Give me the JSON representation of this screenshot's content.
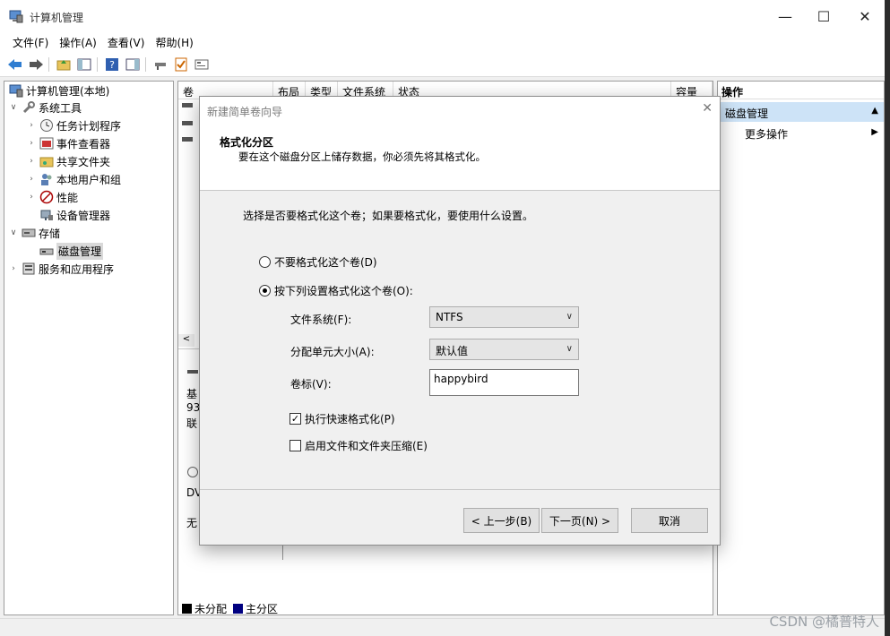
{
  "window": {
    "title": "计算机管理",
    "minimize": "—",
    "maximize": "☐",
    "close": "✕"
  },
  "menu": [
    "文件(F)",
    "操作(A)",
    "查看(V)",
    "帮助(H)"
  ],
  "tree": {
    "root": "计算机管理(本地)",
    "system_tools": "系统工具",
    "task_scheduler": "任务计划程序",
    "event_viewer": "事件查看器",
    "shared_folders": "共享文件夹",
    "local_users": "本地用户和组",
    "performance": "性能",
    "device_manager": "设备管理器",
    "storage": "存储",
    "disk_management": "磁盘管理",
    "services_apps": "服务和应用程序"
  },
  "center": {
    "columns": [
      "卷",
      "布局",
      "类型",
      "文件系统",
      "状态",
      "容量"
    ],
    "partial_texts": [
      "基",
      "93",
      "联",
      "DV",
      "无"
    ],
    "legend": [
      {
        "label": "未分配",
        "color": "#000000"
      },
      {
        "label": "主分区",
        "color": "#000080"
      }
    ]
  },
  "actions": {
    "header": "操作",
    "section": "磁盘管理",
    "more": "更多操作"
  },
  "dialog": {
    "title": "新建简单卷向导",
    "close": "✕",
    "heading": "格式化分区",
    "subheading": "要在这个磁盘分区上储存数据，你必须先将其格式化。",
    "instruction": "选择是否要格式化这个卷；如果要格式化，要使用什么设置。",
    "radio_no_format": "不要格式化这个卷(D)",
    "radio_format": "按下列设置格式化这个卷(O):",
    "fs_label": "文件系统(F):",
    "fs_value": "NTFS",
    "alloc_label": "分配单元大小(A):",
    "alloc_value": "默认值",
    "volume_label": "卷标(V):",
    "volume_value": "happybird",
    "quick_format": "执行快速格式化(P)",
    "compression": "启用文件和文件夹压缩(E)",
    "back": "< 上一步(B)",
    "next": "下一页(N) >",
    "cancel": "取消"
  },
  "watermark": "CSDN @橘普特人"
}
